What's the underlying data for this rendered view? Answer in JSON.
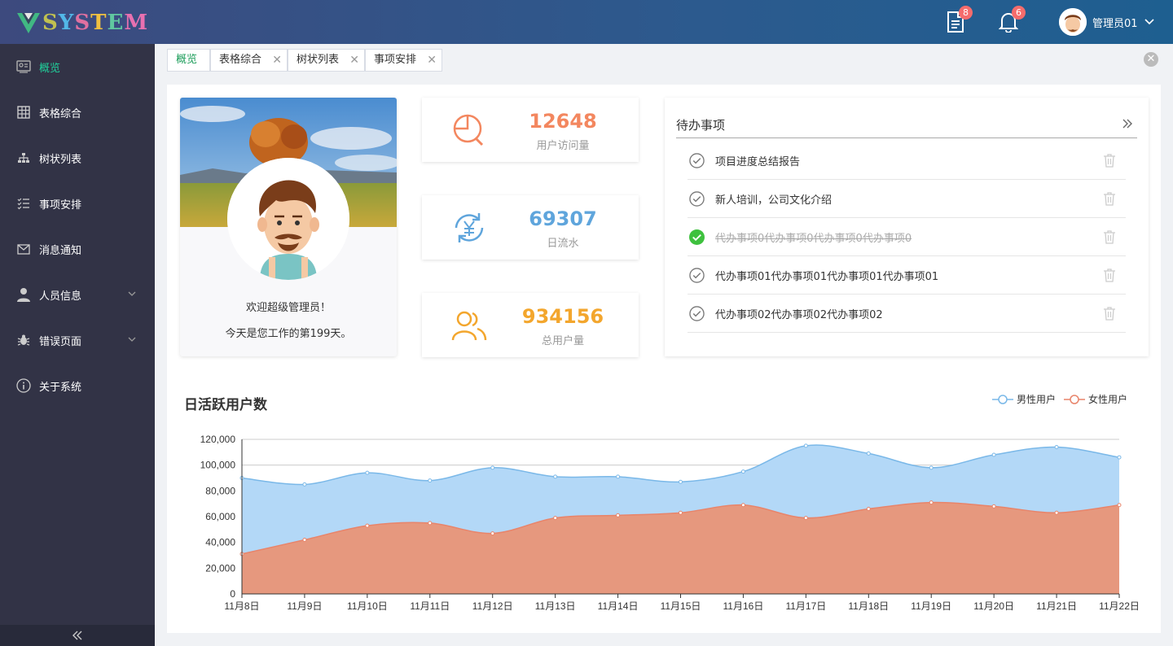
{
  "app": {
    "logo_letters": [
      "S",
      "Y",
      "S",
      "T",
      "E",
      "M"
    ],
    "logo_colors": [
      "#c0c050",
      "#52b8e8",
      "#e070a0",
      "#f0c040",
      "#60c8a0",
      "#e870b0"
    ]
  },
  "header": {
    "doc_badge": "8",
    "bell_badge": "6",
    "user_name": "管理员01",
    "chevron": "chevron-down-icon"
  },
  "sidebar": {
    "items": [
      {
        "label": "概览",
        "icon": "dashboard-icon",
        "active": true
      },
      {
        "label": "表格综合",
        "icon": "table-icon"
      },
      {
        "label": "树状列表",
        "icon": "tree-icon"
      },
      {
        "label": "事项安排",
        "icon": "list-icon"
      },
      {
        "label": "消息通知",
        "icon": "mail-icon"
      },
      {
        "label": "人员信息",
        "icon": "user-icon",
        "expandable": true
      },
      {
        "label": "错误页面",
        "icon": "bug-icon",
        "expandable": true
      },
      {
        "label": "关于系统",
        "icon": "info-icon"
      }
    ],
    "collapse_icon": "double-chevron-left-icon"
  },
  "tabs": [
    {
      "label": "概览",
      "active": true,
      "closable": false
    },
    {
      "label": "表格综合",
      "closable": true
    },
    {
      "label": "树状列表",
      "closable": true
    },
    {
      "label": "事项安排",
      "closable": true
    }
  ],
  "tab_close_glyph": "✕",
  "profile": {
    "welcome": "欢迎超级管理员！",
    "days": "今天是您工作的第199天。"
  },
  "stats": [
    {
      "value": "12648",
      "label": "用户访问量",
      "color": "#f3875f",
      "icon": "mouse-icon"
    },
    {
      "value": "69307",
      "label": "日流水",
      "color": "#5fa5dc",
      "icon": "yuan-refresh-icon"
    },
    {
      "value": "934156",
      "label": "总用户量",
      "color": "#f3a62d",
      "icon": "users-icon"
    }
  ],
  "todo": {
    "title": "待办事项",
    "more_icon": "double-chevron-right-icon",
    "items": [
      {
        "text": "项目进度总结报告",
        "done": false
      },
      {
        "text": "新人培训，公司文化介绍",
        "done": false
      },
      {
        "text": "代办事项0代办事项0代办事项0代办事项0",
        "done": true
      },
      {
        "text": "代办事项01代办事项01代办事项01代办事项01",
        "done": false
      },
      {
        "text": "代办事项02代办事项02代办事项02",
        "done": false
      }
    ]
  },
  "chart_data": {
    "type": "area",
    "title": "日活跃用户数",
    "categories": [
      "11月8日",
      "11月9日",
      "11月10日",
      "11月11日",
      "11月12日",
      "11月13日",
      "11月14日",
      "11月15日",
      "11月16日",
      "11月17日",
      "11月18日",
      "11月19日",
      "11月20日",
      "11月21日",
      "11月22日"
    ],
    "series": [
      {
        "name": "男性用户",
        "color": "#7ab8e8",
        "fill": "#b3d8f7",
        "values": [
          90000,
          85000,
          94000,
          88000,
          98000,
          91000,
          91000,
          87000,
          95000,
          115000,
          109000,
          98000,
          108000,
          114000,
          106000
        ]
      },
      {
        "name": "女性用户",
        "color": "#e8846a",
        "fill": "#e6987e",
        "values": [
          31000,
          42000,
          53000,
          55000,
          47000,
          59000,
          61000,
          63000,
          69000,
          59000,
          66000,
          71000,
          68000,
          63000,
          69000
        ]
      }
    ],
    "y_ticks": [
      "0",
      "20,000",
      "40,000",
      "60,000",
      "80,000",
      "100,000",
      "120,000"
    ],
    "ylim": [
      0,
      120000
    ],
    "grid": true,
    "legend_position": "top-right"
  }
}
